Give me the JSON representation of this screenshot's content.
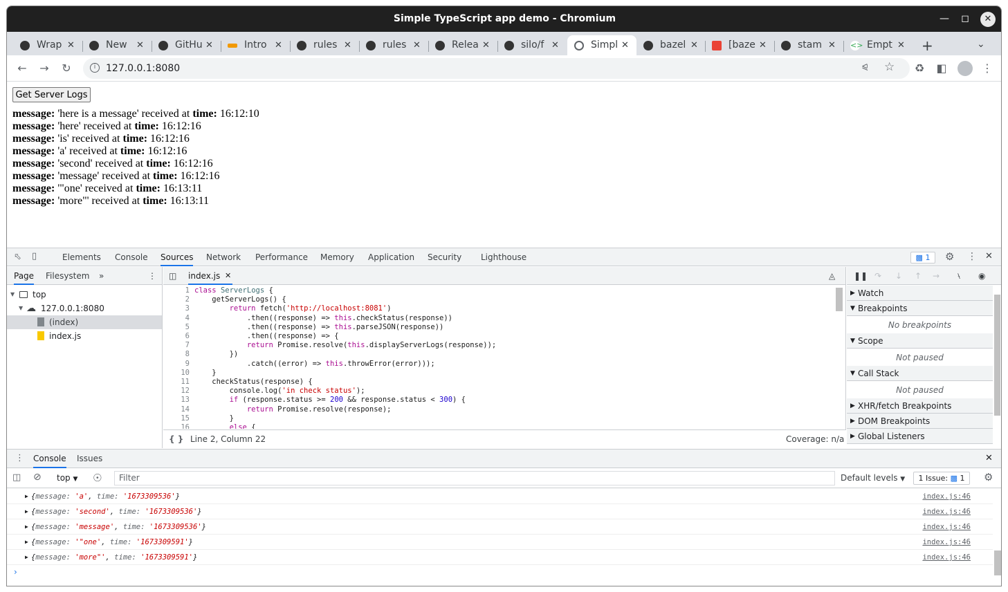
{
  "window": {
    "title": "Simple TypeScript app demo - Chromium"
  },
  "tabs": [
    {
      "label": "Wrap"
    },
    {
      "label": "New"
    },
    {
      "label": "GitHu"
    },
    {
      "label": "Intro"
    },
    {
      "label": "rules"
    },
    {
      "label": "rules"
    },
    {
      "label": "Relea"
    },
    {
      "label": "silo/f"
    },
    {
      "label": "Simpl"
    },
    {
      "label": "bazel"
    },
    {
      "label": "[baze"
    },
    {
      "label": "stam"
    },
    {
      "label": "Empt"
    }
  ],
  "address": {
    "url": "127.0.0.1:8080"
  },
  "page": {
    "button_label": "Get Server Logs",
    "msg_key": "message:",
    "received_at": "received at",
    "time_key": "time:",
    "messages": [
      {
        "text": "'here is a message'",
        "time": "16:12:10"
      },
      {
        "text": "'here'",
        "time": "16:12:16"
      },
      {
        "text": "'is'",
        "time": "16:12:16"
      },
      {
        "text": "'a'",
        "time": "16:12:16"
      },
      {
        "text": "'second'",
        "time": "16:12:16"
      },
      {
        "text": "'message'",
        "time": "16:12:16"
      },
      {
        "text": "'\"one'",
        "time": "16:13:11"
      },
      {
        "text": "'more\"'",
        "time": "16:13:11"
      }
    ]
  },
  "devtools": {
    "tabs": [
      "Elements",
      "Console",
      "Sources",
      "Network",
      "Performance",
      "Memory",
      "Application",
      "Security",
      "Lighthouse"
    ],
    "active_tab": "Sources",
    "issues_count": "1",
    "nav": {
      "tabs": [
        "Page",
        "Filesystem"
      ],
      "tree": [
        "top",
        "127.0.0.1:8080",
        "(index)",
        "index.js"
      ]
    },
    "editor": {
      "file_tab": "index.js",
      "cursor": "Line 2, Column 22",
      "coverage": "Coverage: n/a",
      "line_numbers": [
        "1",
        "2",
        "3",
        "4",
        "5",
        "6",
        "7",
        "8",
        "9",
        "10",
        "11",
        "12",
        "13",
        "14",
        "15",
        "16"
      ]
    },
    "debugger": {
      "sections": [
        "Watch",
        "Breakpoints",
        "Scope",
        "Call Stack",
        "XHR/fetch Breakpoints",
        "DOM Breakpoints",
        "Global Listeners"
      ],
      "no_breakpoints": "No breakpoints",
      "not_paused": "Not paused"
    },
    "drawer": {
      "tabs": [
        "Console",
        "Issues"
      ],
      "context": "top",
      "filter_placeholder": "Filter",
      "levels": "Default levels",
      "issue_badge": "1 Issue:",
      "issue_count": "1",
      "logs": [
        {
          "message": "'a'",
          "time": "'1673309536'",
          "source": "index.js:46"
        },
        {
          "message": "'second'",
          "time": "'1673309536'",
          "source": "index.js:46"
        },
        {
          "message": "'message'",
          "time": "'1673309536'",
          "source": "index.js:46"
        },
        {
          "message": "'\"one'",
          "time": "'1673309591'",
          "source": "index.js:46"
        },
        {
          "message": "'more\"'",
          "time": "'1673309591'",
          "source": "index.js:46"
        }
      ],
      "log_key_message": "message",
      "log_key_time": "time"
    }
  }
}
